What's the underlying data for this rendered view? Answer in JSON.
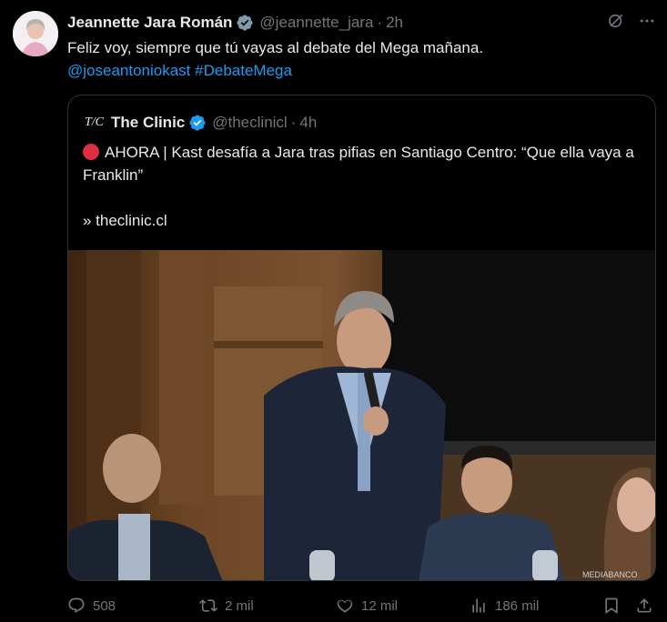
{
  "author": {
    "name": "Jeannette Jara Román",
    "handle": "@jeannette_jara",
    "separator": "·",
    "time": "2h"
  },
  "tweet": {
    "text": "Feliz voy, siempre que tú vayas al debate del Mega mañana.",
    "mention": "@joseantoniokast",
    "hashtag": "#DebateMega"
  },
  "quote": {
    "logo": "T/C",
    "name": "The Clinic",
    "handle": "@theclinicl",
    "separator": "·",
    "time": "4h",
    "text": "AHORA | Kast desafía a Jara tras pifias en Santiago Centro: “Que ella vaya a Franklin”",
    "link": "» theclinic.cl",
    "watermark": "MEDIABANCO"
  },
  "actions": {
    "replies": "508",
    "reposts": "2 mil",
    "likes": "12 mil",
    "views": "186 mil"
  },
  "colors": {
    "background": "#000000",
    "text": "#e7e9ea",
    "muted": "#71767b",
    "accent": "#1d9bf0",
    "border": "#2f3336",
    "alert_red": "#dd2e44"
  },
  "icons": [
    "verified-badge-icon",
    "grok-icon",
    "more-icon",
    "reply-icon",
    "repost-icon",
    "like-icon",
    "views-icon",
    "bookmark-icon",
    "share-icon",
    "red-circle-icon"
  ]
}
